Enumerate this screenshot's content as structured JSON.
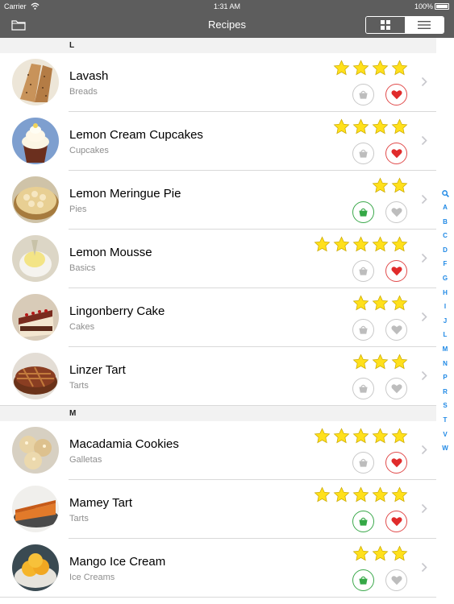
{
  "status": {
    "carrier": "Carrier",
    "time": "1:31 AM",
    "battery": "100%"
  },
  "nav": {
    "title": "Recipes"
  },
  "colors": {
    "bar": "#5d5d5d",
    "accent": "#1e88e5",
    "star": "#ffe01b",
    "heart": "#e02b2b",
    "basket": "#35a846"
  },
  "sections": [
    {
      "letter": "L",
      "rows": [
        {
          "title": "Lavash",
          "category": "Breads",
          "stars": 4,
          "in_basket": false,
          "favorite": true,
          "thumb": "lavash"
        },
        {
          "title": "Lemon Cream Cupcakes",
          "category": "Cupcakes",
          "stars": 4,
          "in_basket": false,
          "favorite": true,
          "thumb": "cupcake"
        },
        {
          "title": "Lemon Meringue Pie",
          "category": "Pies",
          "stars": 2,
          "in_basket": true,
          "favorite": false,
          "thumb": "meringue"
        },
        {
          "title": "Lemon Mousse",
          "category": "Basics",
          "stars": 5,
          "in_basket": false,
          "favorite": true,
          "thumb": "mousse"
        },
        {
          "title": "Lingonberry Cake",
          "category": "Cakes",
          "stars": 3,
          "in_basket": false,
          "favorite": false,
          "thumb": "lingonberry"
        },
        {
          "title": "Linzer Tart",
          "category": "Tarts",
          "stars": 3,
          "in_basket": false,
          "favorite": false,
          "thumb": "linzer"
        }
      ]
    },
    {
      "letter": "M",
      "rows": [
        {
          "title": "Macadamia Cookies",
          "category": "Galletas",
          "stars": 5,
          "in_basket": false,
          "favorite": true,
          "thumb": "cookies"
        },
        {
          "title": "Mamey Tart",
          "category": "Tarts",
          "stars": 5,
          "in_basket": true,
          "favorite": true,
          "thumb": "mamey"
        },
        {
          "title": "Mango Ice Cream",
          "category": "Ice Creams",
          "stars": 3,
          "in_basket": true,
          "favorite": false,
          "thumb": "mango"
        }
      ]
    }
  ],
  "index_letters": [
    "A",
    "B",
    "C",
    "D",
    "F",
    "G",
    "H",
    "I",
    "J",
    "L",
    "M",
    "N",
    "P",
    "R",
    "S",
    "T",
    "V",
    "W"
  ]
}
